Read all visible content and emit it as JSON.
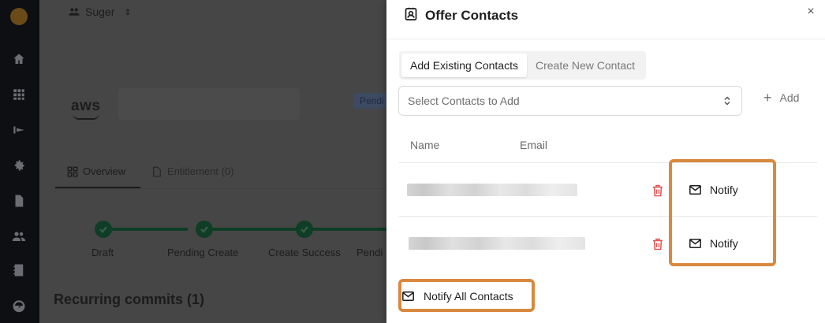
{
  "background": {
    "workspace": "Suger",
    "status_badge": "Pendi",
    "tabs": [
      {
        "label": "Overview"
      },
      {
        "label": "Entitlement (0)"
      }
    ],
    "steps": [
      "Draft",
      "Pending Create",
      "Create Success",
      "Pendi"
    ],
    "section_heading": "Recurring commits (1)",
    "logo_text": "aws"
  },
  "drawer": {
    "title": "Offer Contacts",
    "close_glyph": "×",
    "tabs": [
      {
        "label": "Add Existing Contacts",
        "active": true
      },
      {
        "label": "Create New Contact",
        "active": false
      }
    ],
    "select_placeholder": "Select Contacts to Add",
    "add_label": "Add",
    "columns": {
      "name": "Name",
      "email": "Email"
    },
    "rows": [
      {
        "notify_label": "Notify"
      },
      {
        "notify_label": "Notify"
      }
    ],
    "notify_all_label": "Notify All Contacts"
  },
  "colors": {
    "highlight": "#d9893e",
    "delete": "#e05252",
    "sidebar": "#0d0f13",
    "step_complete": "#0f3d26"
  }
}
